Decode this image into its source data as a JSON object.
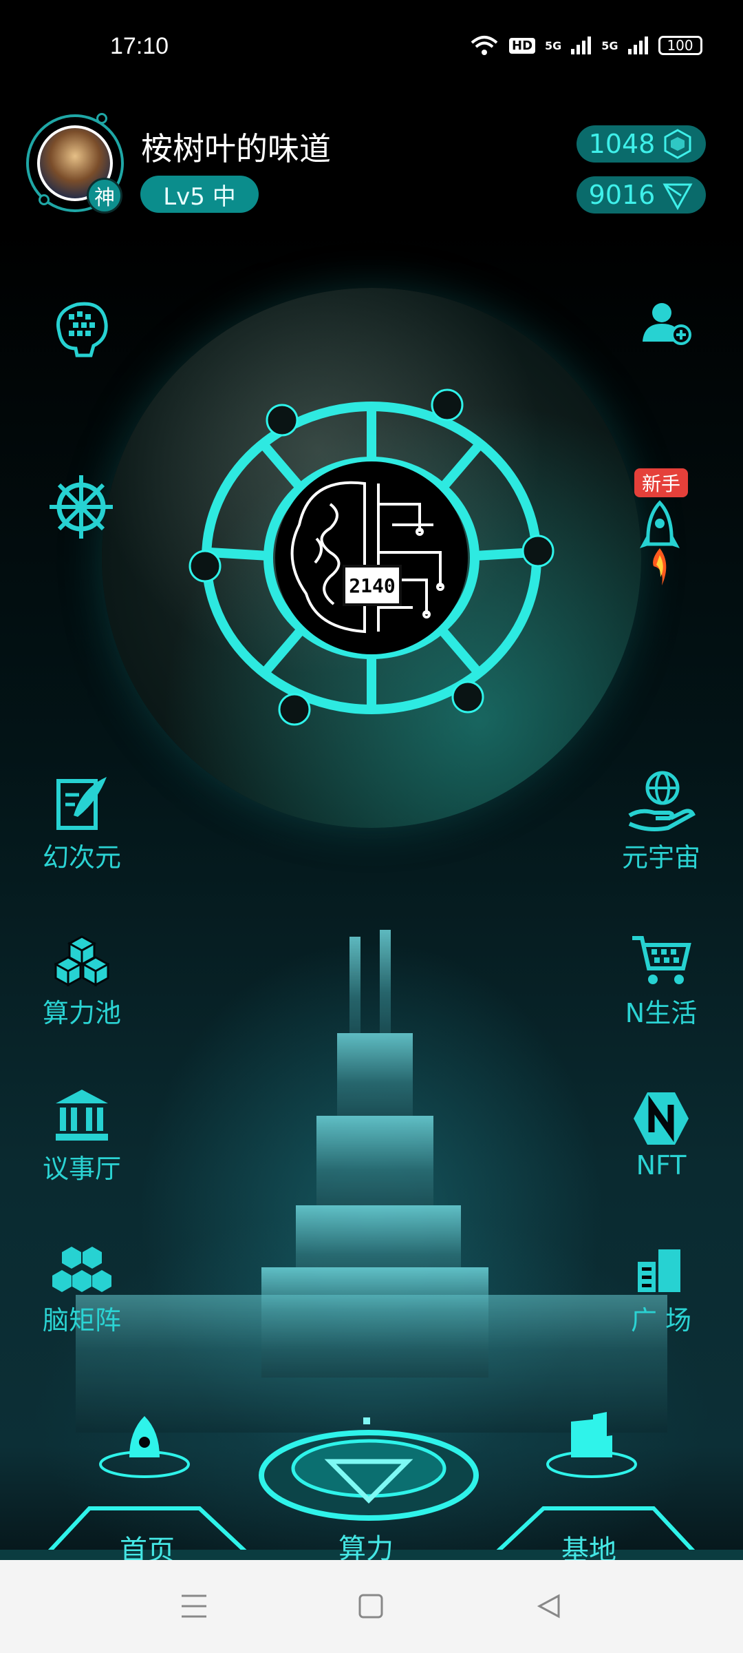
{
  "status_bar": {
    "time": "17:10",
    "hd_label": "HD",
    "net1": "5G",
    "net2": "5G",
    "battery": "100"
  },
  "profile": {
    "username": "桉树叶的味道",
    "level": "Lv5 中",
    "rank_badge": "神",
    "stat_compute": "1048",
    "stat_token": "9016"
  },
  "center": {
    "counter": "2140"
  },
  "badge_new": "新手",
  "left_menu": [
    {
      "label": "幻次元",
      "icon": "feather-doc-icon"
    },
    {
      "label": "算力池",
      "icon": "cubes-icon"
    },
    {
      "label": "议事厅",
      "icon": "bank-icon"
    },
    {
      "label": "脑矩阵",
      "icon": "hexagons-icon"
    }
  ],
  "right_menu": [
    {
      "label": "元宇宙",
      "icon": "globe-hand-icon"
    },
    {
      "label": "N生活",
      "icon": "cart-icon"
    },
    {
      "label": "NFT",
      "icon": "nft-hexagon-icon"
    },
    {
      "label": "广 场",
      "icon": "buildings-icon"
    }
  ],
  "bottom_nav": {
    "home": "首页",
    "compute": "算力",
    "base": "基地"
  },
  "colors": {
    "accent": "#27d2d2",
    "pill": "#0a6b6b",
    "badge": "#e5403a"
  }
}
